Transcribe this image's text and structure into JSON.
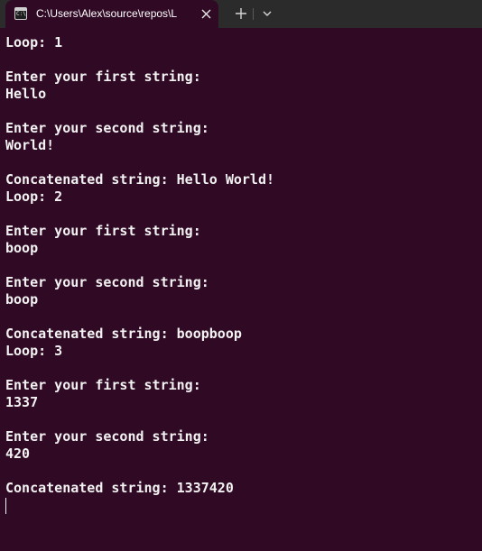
{
  "tab": {
    "title": "C:\\Users\\Alex\\source\\repos\\L",
    "icon": "console-app-icon",
    "icon_glyph": "C:\\"
  },
  "terminal": {
    "lines": [
      "Loop: 1",
      "",
      "Enter your first string:",
      "Hello",
      "",
      "Enter your second string:",
      "World!",
      "",
      "Concatenated string: Hello World!",
      "Loop: 2",
      "",
      "Enter your first string:",
      "boop",
      "",
      "Enter your second string:",
      "boop",
      "",
      "Concatenated string: boopboop",
      "Loop: 3",
      "",
      "Enter your first string:",
      "1337",
      "",
      "Enter your second string:",
      "420",
      "",
      "Concatenated string: 1337420",
      ""
    ]
  },
  "colors": {
    "terminal_bg": "#300a24",
    "tabbar_bg": "#2b2b2b",
    "text": "#f2f2f2"
  }
}
